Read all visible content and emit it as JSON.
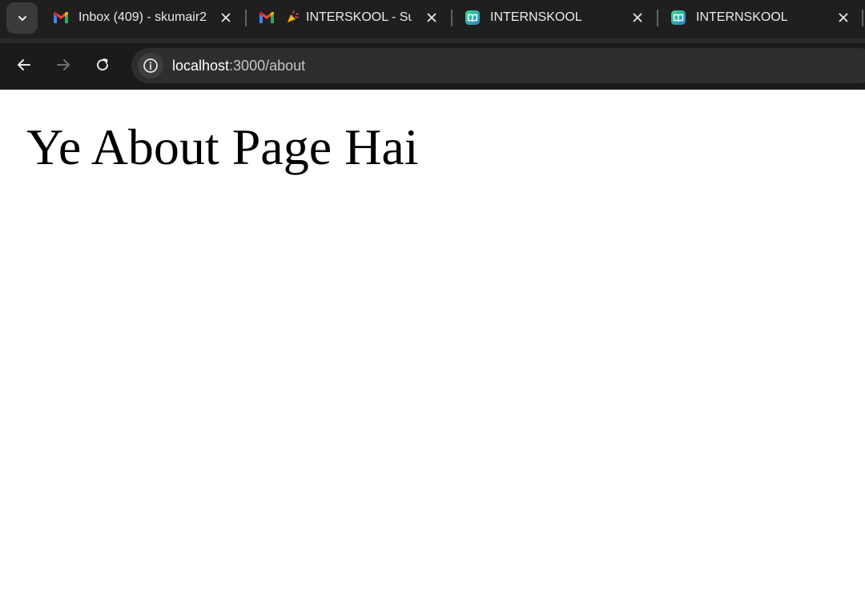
{
  "tabs": [
    {
      "title": "Inbox (409) - skumair2",
      "favicon": "gmail-icon"
    },
    {
      "title": "INTERSKOOL - Sub",
      "favicon": "gmail-icon",
      "extra_icon": "party-popper-icon"
    },
    {
      "title": "INTERNSKOOL",
      "favicon": "book-app-icon"
    },
    {
      "title": "INTERNSKOOL",
      "favicon": "book-app-icon"
    }
  ],
  "toolbar": {
    "url_host": "localhost",
    "url_path": ":3000/about"
  },
  "page": {
    "heading": "Ye About Page Hai"
  }
}
